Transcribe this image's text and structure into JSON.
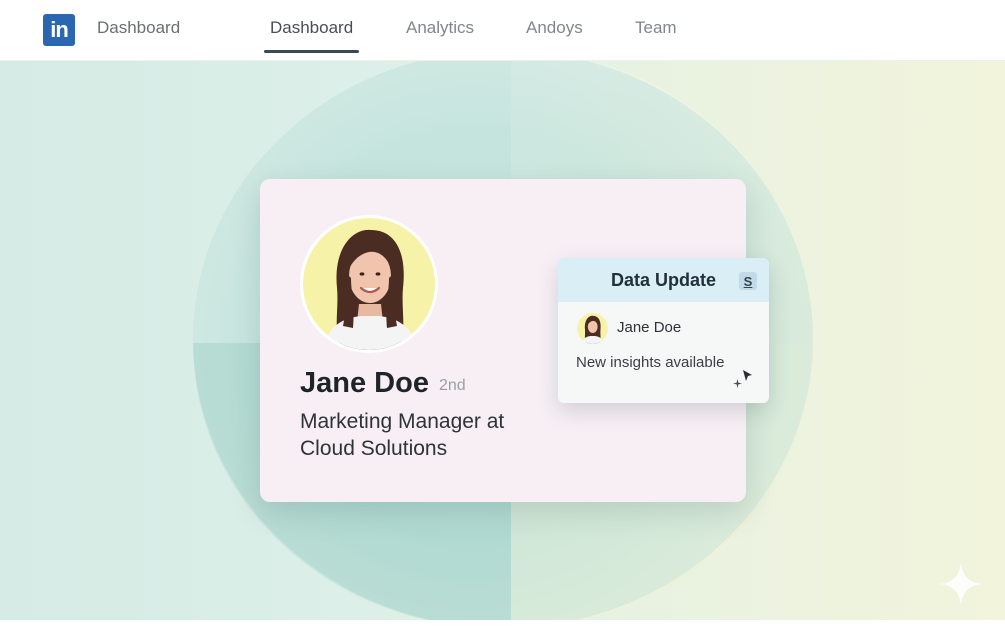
{
  "header": {
    "logo_text": "in",
    "brand_label": "Dashboard",
    "tabs": [
      {
        "label": "Dashboard",
        "active": true
      },
      {
        "label": "Analytics",
        "active": false
      },
      {
        "label": "Andoys",
        "active": false
      },
      {
        "label": "Team",
        "active": false
      }
    ]
  },
  "profile": {
    "name": "Jane Doe",
    "degree": "2nd",
    "title_line1": "Marketing Manager at",
    "title_line2": "Cloud Solutions",
    "avatar_icon": "person-avatar-icon"
  },
  "popup": {
    "title": "Data Update",
    "badge": "S",
    "user_name": "Jane Doe",
    "message": "New insights available"
  },
  "colors": {
    "brand": "#2b67b1",
    "card": "#f7eff4",
    "popup_header": "#d9eef5",
    "avatar_bg": "#f6f3a9"
  }
}
